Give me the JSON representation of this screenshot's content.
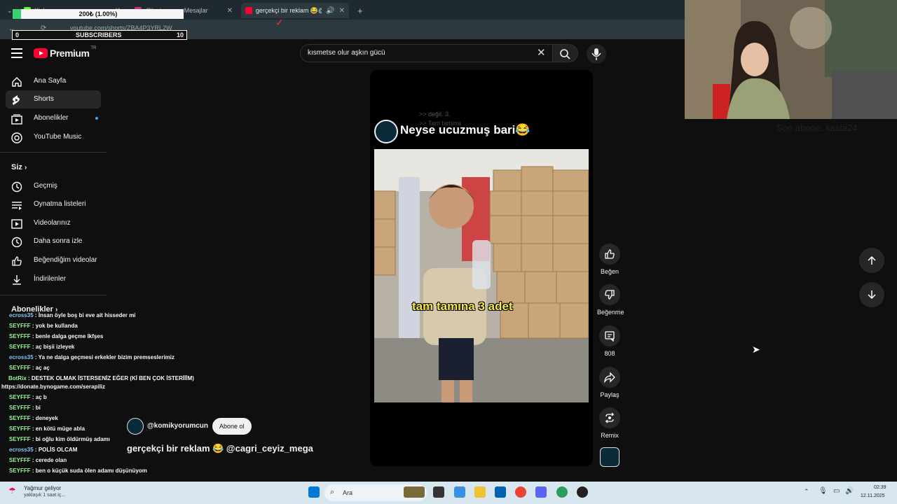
{
  "browser": {
    "tabs": [
      {
        "label": "Kick",
        "color": "#53fc18"
      },
      {
        "label": "@lostmoon... Mesajlar",
        "color": "#d62976"
      },
      {
        "label": "gerçekçi bir reklam 😂@cag",
        "color": "#ff0033"
      }
    ],
    "new_tab": "+",
    "url": "youtube.com/shorts/ZBA4P3YRL2W"
  },
  "overlay": {
    "donation_goal": "200₺ (1.00%)",
    "donation_progress": 0.01,
    "subscribers_label": "SUBSCRIBERS",
    "subscribers_current": "0",
    "subscribers_goal": "10"
  },
  "youtube": {
    "logo_text": "Premium",
    "logo_country": "TR",
    "search_value": "kısmetse olur aşkın gücü",
    "sidebar_main": [
      {
        "label": "Ana Sayfa",
        "icon": "home-icon"
      },
      {
        "label": "Shorts",
        "icon": "shorts-icon",
        "active": true
      },
      {
        "label": "Abonelikler",
        "icon": "subscriptions-icon",
        "dot": true
      },
      {
        "label": "YouTube Music",
        "icon": "music-icon"
      }
    ],
    "you_heading": "Siz",
    "sidebar_you": [
      {
        "label": "Geçmiş",
        "icon": "history-icon"
      },
      {
        "label": "Oynatma listeleri",
        "icon": "playlist-icon"
      },
      {
        "label": "Videolarınız",
        "icon": "video-icon"
      },
      {
        "label": "Daha sonra izle",
        "icon": "clock-icon"
      },
      {
        "label": "Beğendiğim videolar",
        "icon": "like-icon"
      },
      {
        "label": "İndirilenler",
        "icon": "download-icon"
      }
    ],
    "subscriptions_heading": "Abonelikler",
    "short": {
      "title": "Neyse ucuzmuş bari😂",
      "caption": "tam tamına 3 adet",
      "ghost_line_1": ">> değil. 3.",
      "ghost_line_2": ">> Tam tamına",
      "channel": "@komikyorumcun",
      "subscribe": "Abone ol",
      "description": "gerçekçi bir reklam 😂 @cagri_ceyiz_mega"
    },
    "actions": {
      "like": "Beğen",
      "dislike": "Beğenme",
      "comments": "808",
      "share": "Paylaş",
      "remix": "Remix"
    }
  },
  "webcam_caption": "Son abone: kasta24",
  "chat": [
    {
      "user": "ecross35",
      "msg": "İnsan öyle boş bi eve ait hisseder mi"
    },
    {
      "user": "SEYFFF",
      "msg": "yok be kullanda"
    },
    {
      "user": "SEYFFF",
      "msg": "benle dalga geçme lkfşes"
    },
    {
      "user": "SEYFFF",
      "msg": "aç bişii izleyek"
    },
    {
      "user": "ecross35",
      "msg": "Ya ne dalga geçmesi erkekler bizim premseslerimiz"
    },
    {
      "user": "SEYFFF",
      "msg": "aç aç"
    },
    {
      "user": "BotRix",
      "msg": "DESTEK OLMAK İSTERSENİZ EĞER (Kİ BEN ÇOK İSTERİİİM)"
    },
    {
      "user": "",
      "msg": "https://donate.bynogame.com/serapiliz"
    },
    {
      "user": "SEYFFF",
      "msg": "aç b"
    },
    {
      "user": "SEYFFF",
      "msg": "bi"
    },
    {
      "user": "SEYFFF",
      "msg": "deneyek"
    },
    {
      "user": "SEYFFF",
      "msg": "en kötü müge abla"
    },
    {
      "user": "SEYFFF",
      "msg": "bi oğlu kim öldürmüş adamı"
    },
    {
      "user": "ecross35",
      "msg": "POLİS OLCAM"
    },
    {
      "user": "SEYFFF",
      "msg": "cerede olan"
    },
    {
      "user": "SEYFFF",
      "msg": "ben o küçük suda ölen adamı düşünüyom"
    }
  ],
  "taskbar": {
    "weather_title": "Yağmur geliyor",
    "weather_sub": "yaklaşık 1 saat iç...",
    "search": "Ara",
    "time": "02:39",
    "date": "12.11.2025"
  }
}
